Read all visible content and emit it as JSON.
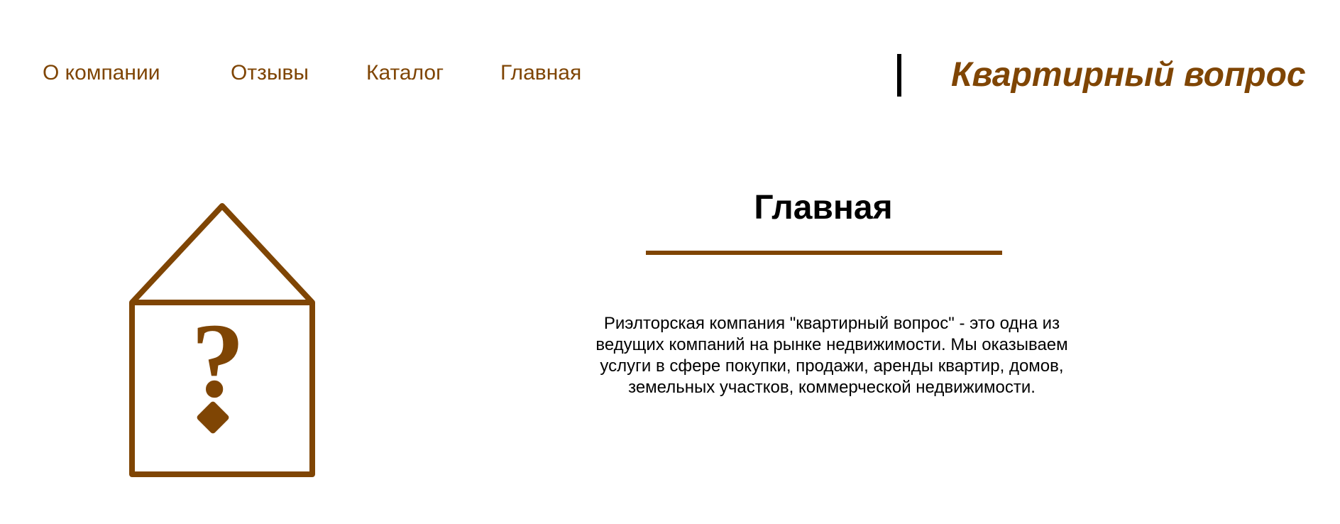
{
  "nav": {
    "about": "О компании",
    "reviews": "Отзывы",
    "catalog": "Каталог",
    "home": "Главная"
  },
  "brand": "Квартирный вопрос",
  "logo": {
    "icon": "house-question-icon",
    "symbol": "?"
  },
  "main": {
    "title": "Главная",
    "intro": "Риэлторская компания \"квартирный вопрос\" - это одна из ведущих компаний на рынке недвижимости. Мы оказываем услуги в сфере покупки, продажи, аренды квартир, домов, земельных участков, коммерческой недвижимости."
  },
  "colors": {
    "accent": "#7f4504",
    "text": "#000000",
    "background": "#ffffff"
  }
}
